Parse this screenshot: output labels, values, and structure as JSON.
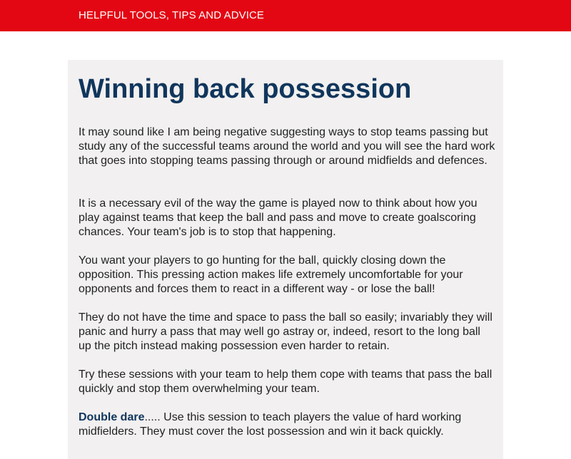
{
  "header": {
    "nav_link": "HELPFUL TOOLS, TIPS AND ADVICE",
    "color": "#e30613"
  },
  "article": {
    "title": "Winning back possession",
    "title_color": "#10365c",
    "paragraphs": [
      "It may sound like I am being negative suggesting ways to stop teams passing but study any of the successful teams around the world and you will see the hard work that goes into stopping teams passing through or around midfields and defences.",
      "It is a necessary evil of the way the game is played now to think about how you play against teams that keep the ball and pass and move to create goalscoring chances. Your team's job is to stop that happening.",
      "You want your players to go hunting for the ball, quickly closing down the opposition. This pressing action makes life extremely uncomfortable for your opponents and forces them to react in a different way - or lose the ball!",
      "They do not have the time and space to pass the ball so easily; invariably they will panic and hurry a pass that may well go astray or, indeed, resort to the long ball up the pitch instead making possession even harder to retain.",
      "Try these sessions with your team to help them cope with teams that pass the ball quickly and stop them overwhelming your team."
    ],
    "session": {
      "link_text": "Double dare",
      "text": "..... Use this session to teach players the value of hard working midfielders. They must cover the lost possession and win it back quickly."
    }
  }
}
